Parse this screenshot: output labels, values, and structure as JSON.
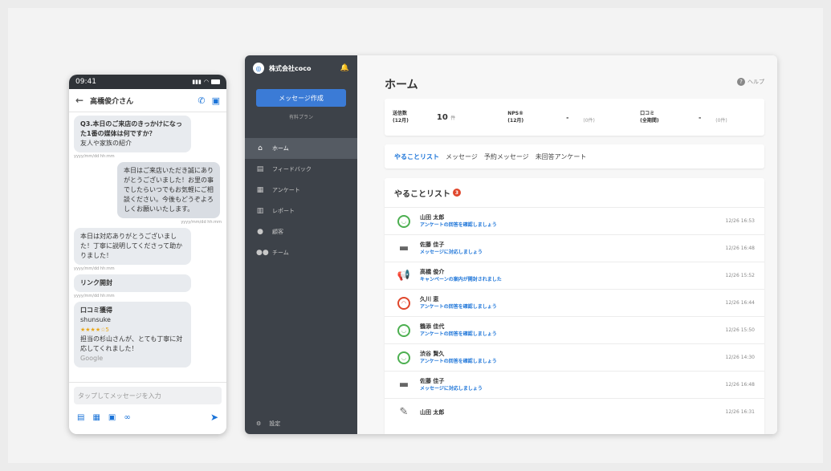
{
  "phone": {
    "status_time": "09:41",
    "contact_name": "高橋俊介さん",
    "messages": [
      {
        "side": "left",
        "title": "Q3.本日のご来店のきっかけになった1番の媒体は何ですか？",
        "body": "友人や家族の紹介",
        "ts": "yyyy/mm/dd hh:mm"
      },
      {
        "side": "right",
        "body": "本日はご来店いただき誠にありがとうございました！お里の事でしたらいつでもお気軽にご相談ください。今後もどうぞよろしくお願いいたします。",
        "ts": "yyyy/mm/dd hh:mm"
      },
      {
        "side": "left",
        "body": "本日は対応ありがとうございました！丁寧に説明してくださって助かりました！",
        "ts": "yyyy/mm/dd hh:mm"
      },
      {
        "side": "left",
        "title": "リンク開封",
        "ts": "yyyy/mm/dd hh:mm"
      }
    ],
    "review": {
      "title": "口コミ獲得",
      "user": "shunsuke",
      "stars": "★★★★☆5",
      "body": "担当の杉山さんが、とても丁寧に対応してくれました！",
      "source": "Google"
    },
    "composer_placeholder": "タップしてメッセージを入力"
  },
  "sidebar": {
    "company": "株式会社coco",
    "compose_label": "メッセージ作成",
    "plan": "有料プラン",
    "items": [
      {
        "label": "ホーム",
        "icon": "⌂",
        "active": true
      },
      {
        "label": "フィードバック",
        "icon": "▤",
        "active": false
      },
      {
        "label": "アンケート",
        "icon": "▦",
        "active": false
      },
      {
        "label": "レポート",
        "icon": "▥",
        "active": false
      },
      {
        "label": "顧客",
        "icon": "●",
        "active": false
      },
      {
        "label": "チーム",
        "icon": "●●",
        "active": false
      }
    ],
    "settings_label": "設定"
  },
  "main": {
    "title": "ホーム",
    "help": "ヘルプ",
    "stats": [
      {
        "label1": "送信数",
        "label2": "(12月)",
        "value": "10",
        "unit": "件"
      },
      {
        "label1": "NPS®",
        "label2": "(12月)",
        "value": "-",
        "count": "(0件)"
      },
      {
        "label1": "口コミ",
        "label2": "(全期間)",
        "value": "-",
        "count": "(0件)"
      }
    ],
    "tabs": [
      {
        "label": "やることリスト",
        "active": true
      },
      {
        "label": "メッセージ",
        "active": false
      },
      {
        "label": "予約メッセージ",
        "active": false
      },
      {
        "label": "未回答アンケート",
        "active": false
      }
    ],
    "todo": {
      "title": "やることリスト",
      "badge": "3",
      "rows": [
        {
          "name": "山田 太郎",
          "msg": "アンケートの回答を確認しましょう",
          "time": "12/26 16:53",
          "icon": "good"
        },
        {
          "name": "佐藤 佳子",
          "msg": "メッセージに対応しましょう",
          "time": "12/26 16:48",
          "icon": "chat"
        },
        {
          "name": "高橋 俊介",
          "msg": "キャンペーンの案内が開封されました",
          "time": "12/26 15:52",
          "icon": "megaphone"
        },
        {
          "name": "久川 恵",
          "msg": "アンケートの回答を確認しましょう",
          "time": "12/26 16:44",
          "icon": "bad"
        },
        {
          "name": "鶴添 佳代",
          "msg": "アンケートの回答を確認しましょう",
          "time": "12/26 15:50",
          "icon": "good"
        },
        {
          "name": "渋谷 賢久",
          "msg": "アンケートの回答を確認しましょう",
          "time": "12/26 14:30",
          "icon": "good"
        },
        {
          "name": "佐藤 佳子",
          "msg": "メッセージに対応しましょう",
          "time": "12/26 16:48",
          "icon": "chat"
        },
        {
          "name": "山田 太郎",
          "msg": "",
          "time": "12/26 16:31",
          "icon": "edit"
        }
      ]
    }
  },
  "colors": {
    "accent": "#1a73d8",
    "sidebar": "#3d4249",
    "good": "#4caf50",
    "bad": "#e0472c"
  }
}
